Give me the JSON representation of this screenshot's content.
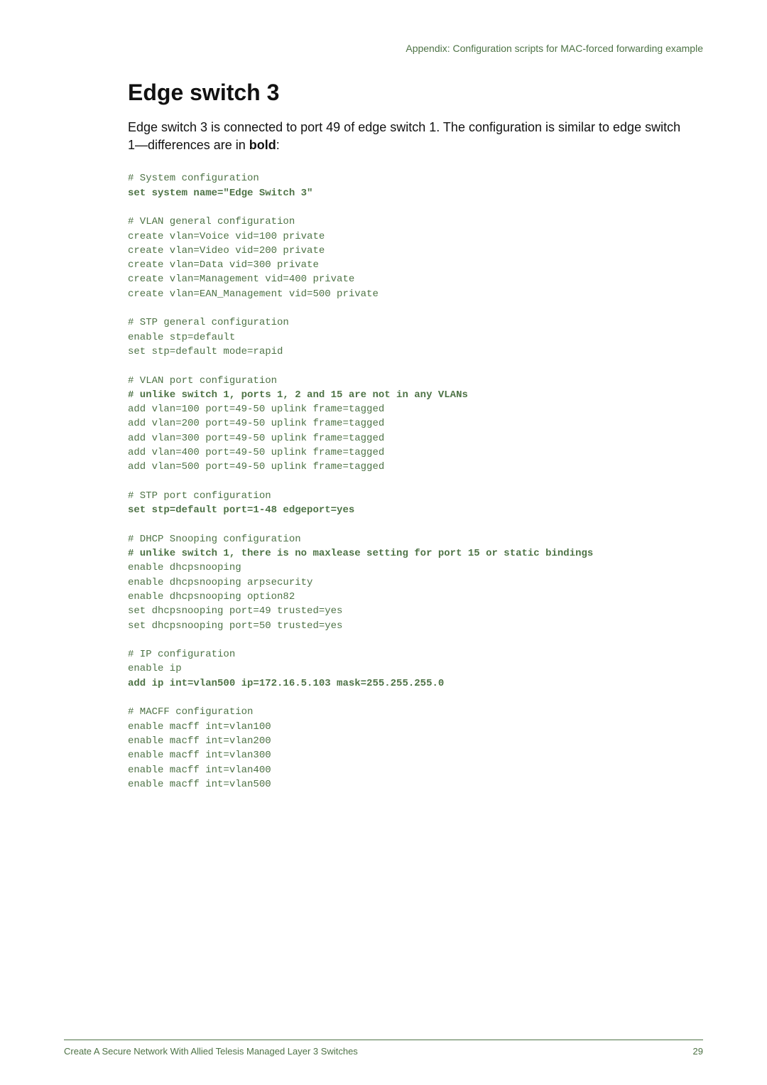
{
  "doc": {
    "running_header": "Appendix: Configuration scripts for MAC-forced forwarding example",
    "section_title": "Edge switch 3",
    "intro_pre": "Edge switch 3 is connected to port 49 of edge switch 1. The configuration is similar to edge switch 1—differences are in ",
    "intro_bold": "bold",
    "intro_post": ":",
    "footer_left": "Create A Secure Network With Allied Telesis Managed Layer 3 Switches",
    "footer_right": "29"
  },
  "config": {
    "lines": [
      {
        "t": "# System configuration"
      },
      {
        "t": "set system name=\"Edge Switch 3\"",
        "b": true
      },
      {
        "t": ""
      },
      {
        "t": "# VLAN general configuration"
      },
      {
        "t": "create vlan=Voice vid=100 private"
      },
      {
        "t": "create vlan=Video vid=200 private"
      },
      {
        "t": "create vlan=Data vid=300 private"
      },
      {
        "t": "create vlan=Management vid=400 private"
      },
      {
        "t": "create vlan=EAN_Management vid=500 private"
      },
      {
        "t": ""
      },
      {
        "t": "# STP general configuration"
      },
      {
        "t": "enable stp=default"
      },
      {
        "t": "set stp=default mode=rapid"
      },
      {
        "t": ""
      },
      {
        "t": "# VLAN port configuration"
      },
      {
        "t": "# unlike switch 1, ports 1, 2 and 15 are not in any VLANs",
        "b": true
      },
      {
        "t": "add vlan=100 port=49-50 uplink frame=tagged"
      },
      {
        "t": "add vlan=200 port=49-50 uplink frame=tagged"
      },
      {
        "t": "add vlan=300 port=49-50 uplink frame=tagged"
      },
      {
        "t": "add vlan=400 port=49-50 uplink frame=tagged"
      },
      {
        "t": "add vlan=500 port=49-50 uplink frame=tagged"
      },
      {
        "t": ""
      },
      {
        "t": "# STP port configuration"
      },
      {
        "t": "set stp=default port=1-48 edgeport=yes",
        "b": true
      },
      {
        "t": ""
      },
      {
        "t": "# DHCP Snooping configuration"
      },
      {
        "t": "# unlike switch 1, there is no maxlease setting for port 15 or static bindings",
        "b": true
      },
      {
        "t": "enable dhcpsnooping"
      },
      {
        "t": "enable dhcpsnooping arpsecurity"
      },
      {
        "t": "enable dhcpsnooping option82"
      },
      {
        "t": "set dhcpsnooping port=49 trusted=yes"
      },
      {
        "t": "set dhcpsnooping port=50 trusted=yes"
      },
      {
        "t": ""
      },
      {
        "t": "# IP configuration"
      },
      {
        "t": "enable ip"
      },
      {
        "t": "add ip int=vlan500 ip=172.16.5.103 mask=255.255.255.0",
        "b": true
      },
      {
        "t": ""
      },
      {
        "t": "# MACFF configuration"
      },
      {
        "t": "enable macff int=vlan100"
      },
      {
        "t": "enable macff int=vlan200"
      },
      {
        "t": "enable macff int=vlan300"
      },
      {
        "t": "enable macff int=vlan400"
      },
      {
        "t": "enable macff int=vlan500"
      }
    ]
  }
}
